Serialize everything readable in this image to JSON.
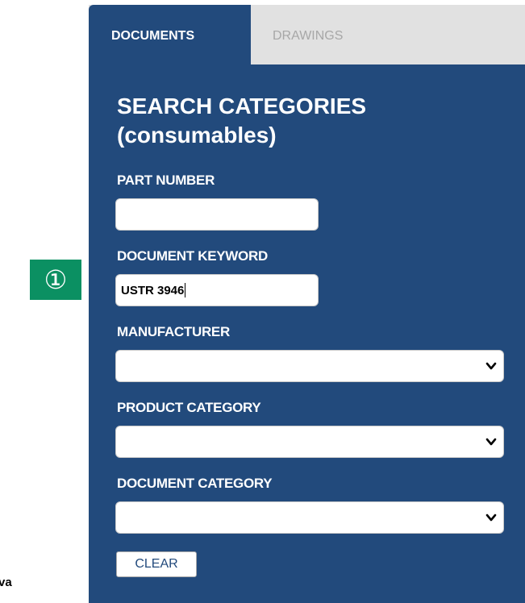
{
  "annotation": {
    "step_marker": "①"
  },
  "edge_text": "va",
  "tabs": [
    {
      "label": "DOCUMENTS",
      "active": true
    },
    {
      "label": "DRAWINGS",
      "active": false
    }
  ],
  "panel": {
    "title_line1": "SEARCH CATEGORIES",
    "title_line2": "(consumables)",
    "part_number": {
      "label": "PART NUMBER",
      "value": ""
    },
    "document_keyword": {
      "label": "DOCUMENT KEYWORD",
      "value": "USTR 3946"
    },
    "manufacturer": {
      "label": "MANUFACTURER",
      "selected": ""
    },
    "product_category": {
      "label": "PRODUCT CATEGORY",
      "selected": ""
    },
    "document_category": {
      "label": "DOCUMENT CATEGORY",
      "selected": ""
    },
    "clear_label": "CLEAR"
  },
  "colors": {
    "panel_bg": "#224a7c",
    "tab_bar_bg": "#e1e1e1",
    "step_marker_bg": "#0b9062"
  },
  "icons": {
    "dropdown": "chevron-down-icon"
  }
}
